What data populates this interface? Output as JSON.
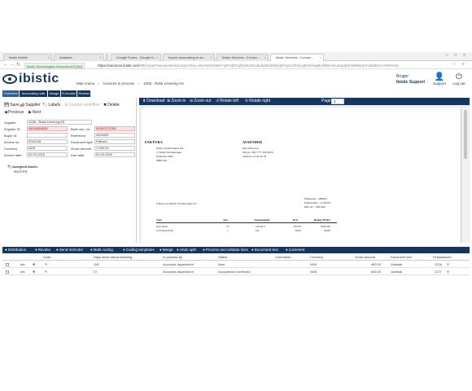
{
  "browser": {
    "tabs": [
      {
        "label": "Ibistic Mobile"
      },
      {
        "label": "Analytics"
      },
      {
        "label": "Ibistic Technologies Denmark"
      },
      {
        "label": "Google Forms - Google D..."
      },
      {
        "label": "Issues associating to an..."
      },
      {
        "label": "Ibistic Services - Invoice..."
      },
      {
        "label": "Ibistic Services - Invoice..."
      }
    ],
    "secure_label": "Ibistic Technologies Denmark A/S [DK]",
    "url_host": "https://services.ibistic.net",
    "url_path": "/NR/AspxFrameworkHost.aspx?key=ntUHx0mO6KY1jPo3bTUjfVuNUhsa3Lbs6GtGKEqIhTgCnl7l3vcyBzOHepBAfM5nAKuXxejEKcNMNp3n%2bbDmuYKW%2b"
  },
  "app": {
    "logo_text": "ibistic",
    "breadcrumbs": [
      "Main menu",
      "Invoices in process",
      "1006 - Rask Levering AS"
    ],
    "user_role": "Bruger",
    "user_org": "Ibistic Support",
    "support_label": "Support",
    "logout_label": "Log out"
  },
  "side_tabs": [
    "Overview",
    "Accounting note",
    "Image",
    "E-invoice",
    "Review"
  ],
  "left_toolbar": {
    "save": "Save",
    "supplier": "Supplier",
    "labels": "Labels",
    "custom": "Custom workflow",
    "delete": "Delete",
    "previous": "Previous",
    "next": "Next"
  },
  "fields": {
    "supplier_label": "Supplier",
    "supplier_value": "1006 - Rask Levering AS",
    "supplier_id_label": "Supplier ID",
    "supplier_id_value": "44534658262",
    "bank_acc_label": "Bank acc. no.",
    "bank_acc_value": "59267974763",
    "buyer_id_label": "Buyer ID",
    "buyer_id_value": "",
    "reference_label": "Reference",
    "reference_value": "4524052",
    "invoice_no_label": "Invoice no.",
    "invoice_no_value": "5242118",
    "doc_type_label": "Document type",
    "doc_type_value": "Faktura",
    "currency_label": "Currency",
    "currency_value": "NOK",
    "gross_label": "Gross amount",
    "gross_value": "1 090,00",
    "invoice_date_label": "Invoice date",
    "invoice_date_value": "02.03.2016",
    "due_date_label": "Due date",
    "due_date_value": "01.03.2016"
  },
  "assigned": {
    "title": "Assigned labels:",
    "value": "MASTER"
  },
  "viewer_toolbar": {
    "download": "Download",
    "zoom_in": "Zoom in",
    "zoom_out": "Zoom out",
    "rotate_left": "Rotate left",
    "rotate_right": "Rotate right",
    "page_label": "Page",
    "page_value": "1"
  },
  "document": {
    "title": "FAKTURA",
    "sender_title": "AVSENDER",
    "buyer_lines": [
      "Ibistic Technologies AS",
      "v/ Walle Varemottakel",
      "Postboks 2000",
      "0909 Vik"
    ],
    "sender_lines": [
      "Ond Pizza AS",
      "Org.nr.: 997 777 333 MVA",
      "Telefon: 12 34 56 78"
    ],
    "recipient": "Faktura fra Ibistic Technologies AS",
    "meta_lines": [
      "Fakturanr. : 290803",
      "Fakturadato : 12.09.08",
      "Ditt ref. : 556-094"
    ],
    "table_headers": [
      "Vare",
      "Ant.",
      "Varenummer",
      "Pris",
      "Beløp (NOK)"
    ],
    "table_rows": [
      [
        "Stor pizza",
        "15",
        "GP-65-5",
        "570,00",
        "8550,00"
      ],
      [
        "Levering kvild",
        "1",
        "LK",
        "30,00",
        "30,00"
      ]
    ]
  },
  "grid_toolbar": [
    "Distribution",
    "Revoke",
    "Send reminder",
    "Multi coding",
    "Coding templates",
    "Merge",
    "Undo split",
    "Process and validate lines",
    "Document text",
    "Comment"
  ],
  "grid": {
    "headers": [
      "Code",
      "Days since last processing",
      "In process by",
      "Status",
      "Comments",
      "Currency",
      "Gross amount",
      "Document text",
      "Finansikonto"
    ],
    "rows": [
      {
        "code": "mlu",
        "days": "118",
        "process_by": "Accounts department",
        "status": "New",
        "comments": "",
        "currency": "NOK",
        "gross": "450,00",
        "doc_text": "Varetalk",
        "account": "1216"
      },
      {
        "code": "mlu",
        "days": "27",
        "process_by": "Accounts department",
        "status": "Acceptance confirmed",
        "comments": "",
        "currency": "NOK",
        "gross": "840,00",
        "doc_text": "Varetalk",
        "account": "1277"
      }
    ]
  },
  "colors": {
    "brand": "#14365f",
    "tab_active": "#2b5f99",
    "error_fill": "#fde4e4"
  }
}
